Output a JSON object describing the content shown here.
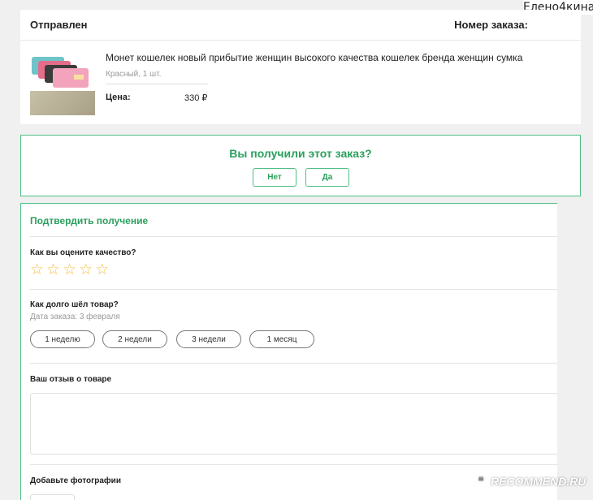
{
  "username": "Елено4кина",
  "order": {
    "status": "Отправлен",
    "order_number_label": "Номер заказа:",
    "product_title": "Монет кошелек новый прибытие женщин высокого качества кошелек бренда женщин сумка",
    "variant": "Красный, 1 шт.",
    "price_label": "Цена:",
    "price_value": "330 ₽"
  },
  "question": {
    "text": "Вы получили этот заказ?",
    "no_label": "Нет",
    "yes_label": "Да"
  },
  "confirm": {
    "title": "Подтвердить получение",
    "rating_question": "Как вы оцените качество?",
    "rating_value": 0,
    "rating_max": 5,
    "delivery_question": "Как долго шёл товар?",
    "order_date": "Дата заказа: 3 февраля",
    "durations": [
      "1 неделю",
      "2 недели",
      "3 недели",
      "1 месяц"
    ],
    "review_label": "Ваш отзыв о товаре",
    "review_value": "",
    "photos_label": "Добавьте фотографии"
  },
  "watermark": {
    "text": "RECOMMEND.RU",
    "icon": "recommend-logo-icon"
  },
  "colors": {
    "accent": "#2aa05e",
    "border_accent": "#4dbf84",
    "star": "#f0c24a"
  }
}
